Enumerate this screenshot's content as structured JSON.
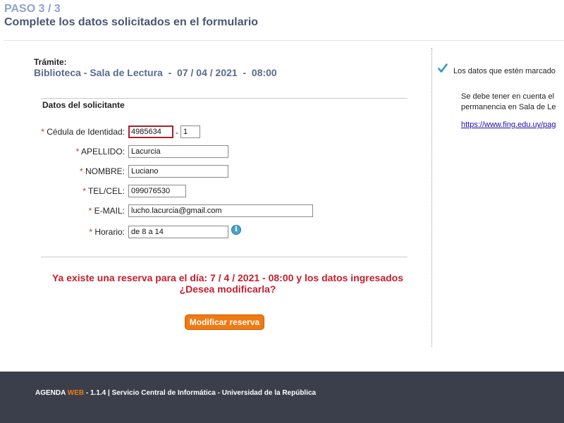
{
  "header": {
    "step": "PASO 3 / 3",
    "subtitle": "Complete los datos solicitados en el formulario"
  },
  "tramite": {
    "label": "Trámite:",
    "value": "Biblioteca - Sala de Lectura  -  07 / 04 / 2021  -  08:00"
  },
  "form": {
    "section_title": "Datos del solicitante",
    "required_mark": "*",
    "cedula": {
      "label": " Cédula de Identidad:",
      "value": "4985634",
      "check_digit": "1",
      "separator": "-"
    },
    "apellido": {
      "label": " APELLIDO:",
      "value": "Lacurcia"
    },
    "nombre": {
      "label": " NOMBRE:",
      "value": "Luciano"
    },
    "tel": {
      "label": " TEL/CEL:",
      "value": "099076530"
    },
    "email": {
      "label": " E-MAIL:",
      "value": "lucho.lacurcia@gmail.com"
    },
    "horario": {
      "label": " Horario:",
      "value": "de 8 a 14"
    },
    "info_icon": "info-icon"
  },
  "alert": {
    "line1": "Ya existe una reserva para el día: 7 / 4 / 2021 - 08:00 y los datos ingresados",
    "line2": "¿Desea modificarla?"
  },
  "button": {
    "label": "Modificar reserva"
  },
  "sidebar": {
    "check_icon": "checkmark-icon",
    "note": "Los datos que estén marcado",
    "text_line1": "Se debe tener en cuenta el",
    "text_line2": "permanencia en Sala de Le",
    "link": "https://www.fing.edu.uy/pag"
  },
  "footer": {
    "agenda": "AGENDA ",
    "web": "WEB",
    "rest": " - 1.1.4 | Servicio Central de Informática - Universidad de la República"
  },
  "colors": {
    "accent_orange": "#f07a12",
    "error_red": "#c41e2d",
    "footer_bg": "#3a3f4b",
    "step_blue": "#8fa3c8"
  }
}
